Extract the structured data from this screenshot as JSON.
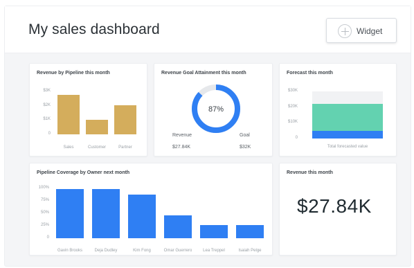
{
  "header": {
    "title": "My sales dashboard",
    "widget_button_label": "Widget",
    "widget_button_icon": "plus-circle-icon"
  },
  "colors": {
    "gold": "#d4ad5c",
    "blue": "#2f7ff3",
    "teal": "#63d2b0",
    "ring_track": "#e6e8eb",
    "panel_bg": "#f4f5f7"
  },
  "cards": {
    "pipeline": {
      "title": "Revenue by Pipeline this month"
    },
    "goal": {
      "title": "Revenue Goal Attainment this month",
      "percent_label": "87%",
      "percent": 87,
      "left_label": "Revenue",
      "left_value": "$27.84K",
      "right_label": "Goal",
      "right_value": "$32K"
    },
    "forecast": {
      "title": "Forecast this month"
    },
    "coverage": {
      "title": "Pipeline Coverage by Owner next month"
    },
    "revenue": {
      "title": "Revenue this month",
      "value": "$27.84K"
    }
  },
  "chart_data": [
    {
      "type": "bar",
      "title": "Revenue by Pipeline this month",
      "categories": [
        "Sales",
        "Customer",
        "Partner"
      ],
      "values": [
        2.75,
        1.0,
        2.05
      ],
      "yticks": [
        "$3K",
        "$2K",
        "$1K",
        "0"
      ],
      "ylim": [
        0,
        3
      ],
      "color": "#d4ad5c"
    },
    {
      "type": "bar",
      "title": "Forecast this month",
      "categories": [
        "Total forecasted value"
      ],
      "series": [
        {
          "values": [
            0.5
          ],
          "color": "#2f7ff3"
        },
        {
          "values": [
            1.7
          ],
          "color": "#63d2b0"
        }
      ],
      "yticks": [
        "$30K",
        "$20K",
        "$10K",
        "0"
      ],
      "ylim": [
        0,
        3
      ],
      "stacked": true
    },
    {
      "type": "bar",
      "title": "Pipeline Coverage by Owner next month",
      "categories": [
        "Gavin Brooks",
        "Deja Dudley",
        "Kim Fong",
        "Omar Guerrero",
        "Lea Treppel",
        "Isaiah Pelge"
      ],
      "values": [
        98,
        98,
        88,
        46,
        27,
        27
      ],
      "yticks": [
        "100%",
        "75%",
        "50%",
        "25%",
        "0"
      ],
      "ylim": [
        0,
        100
      ],
      "color": "#2f7ff3"
    }
  ]
}
